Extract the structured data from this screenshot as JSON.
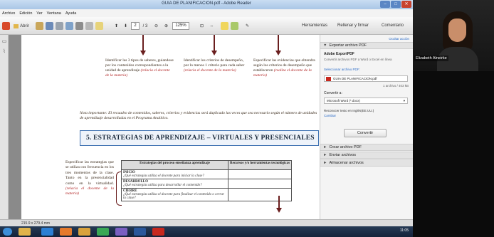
{
  "window": {
    "title": "GUIA DE PLANIFICACION.pdf - Adobe Reader"
  },
  "menubar": [
    "Archivo",
    "Edición",
    "Ver",
    "Ventana",
    "Ayuda"
  ],
  "toolbar": {
    "open_label": "Abrir",
    "page_current": "2",
    "page_total": "/ 3",
    "zoom": "125%",
    "tools_label": "Herramientas",
    "fill_sign_label": "Rellenar y firmar",
    "comment_label": "Comentario"
  },
  "document": {
    "columns": [
      {
        "text": "Identificar las 3 tipos de saberes, guiandose por los contenidos correspondientes a la unidad de aprendizaje",
        "note": "(relacia el docente de la materia)"
      },
      {
        "text": "Identificar los criterios de desempeño, por lo menos 1 criterio para cada saber",
        "note": "(relacia el docente de la materia)"
      },
      {
        "text": "Especificar las evidencias que obtendra según los criterios de desempeño que estableceron",
        "note": "(realiza el docente de la materia)"
      }
    ],
    "important_note": "Nota importante: El recuadro de contenidos, saberes, criterios y evidencias será duplicado las veces que sea necesario según el número de unidades de aprendizaje desarrolladas en el Programa Analítico.",
    "section_heading": "5.   ESTRATEGIAS DE APRENDIZAJE – VIRTUALES Y PRESENCIALES",
    "left_text": "Especificar las estrategias que se utiliza con frecuencia en los tres momentos de la clase. Tanto en la presencialidad como en la virtualidad.",
    "left_note": "(relacia el docente de la materia)",
    "table": {
      "headers": [
        "Estrategias del proceso enseñanza aprendizaje",
        "Recursos y/o herramientas tecnológicas"
      ],
      "rows": [
        {
          "label": "INICIO",
          "desc": "¿Qué estrategias utiliza el docente para iniciar la clase?"
        },
        {
          "label": "DESARROLLO",
          "desc": "¿Qué estrategias utiliza para desarrollar el contenido?"
        },
        {
          "label": "CIERRE",
          "desc": "¿Qué estrategias utiliza el docente para finalizar el contenido o cerrar la clase?"
        }
      ]
    }
  },
  "status_bar": {
    "page_size": "215.9 x 279.4 mm"
  },
  "right_pane": {
    "hide_label": "Ocultar acción",
    "export_header": "Exportar archivo PDF",
    "export_title": "Adobe ExportPDF",
    "export_sub": "Convertir archivos PDF a Word o Excel en línea",
    "select_label": "Seleccionar archivo PDF:",
    "file_name": "GUIA DE PLANIFICACION.pdf",
    "file_count": "1 archivo / 403 kB",
    "convert_to_label": "Convertir a:",
    "convert_to_value": "Microsoft Word (*.docx)",
    "recognize_label": "Reconocer texto en Inglés(EE.UU.)",
    "change_link": "Cambiar",
    "convert_button": "Convertir",
    "sections": [
      "Crear archivo PDF",
      "Enviar archivos",
      "Almacenar archivos"
    ]
  },
  "taskbar": {
    "tray_time": "11:05"
  },
  "webcam": {
    "participant_name": "Elizabeth Alneirke"
  },
  "colors": {
    "heading_border": "#3b6fb0",
    "arrow": "#6a1f1f",
    "note_red": "#b02020"
  }
}
